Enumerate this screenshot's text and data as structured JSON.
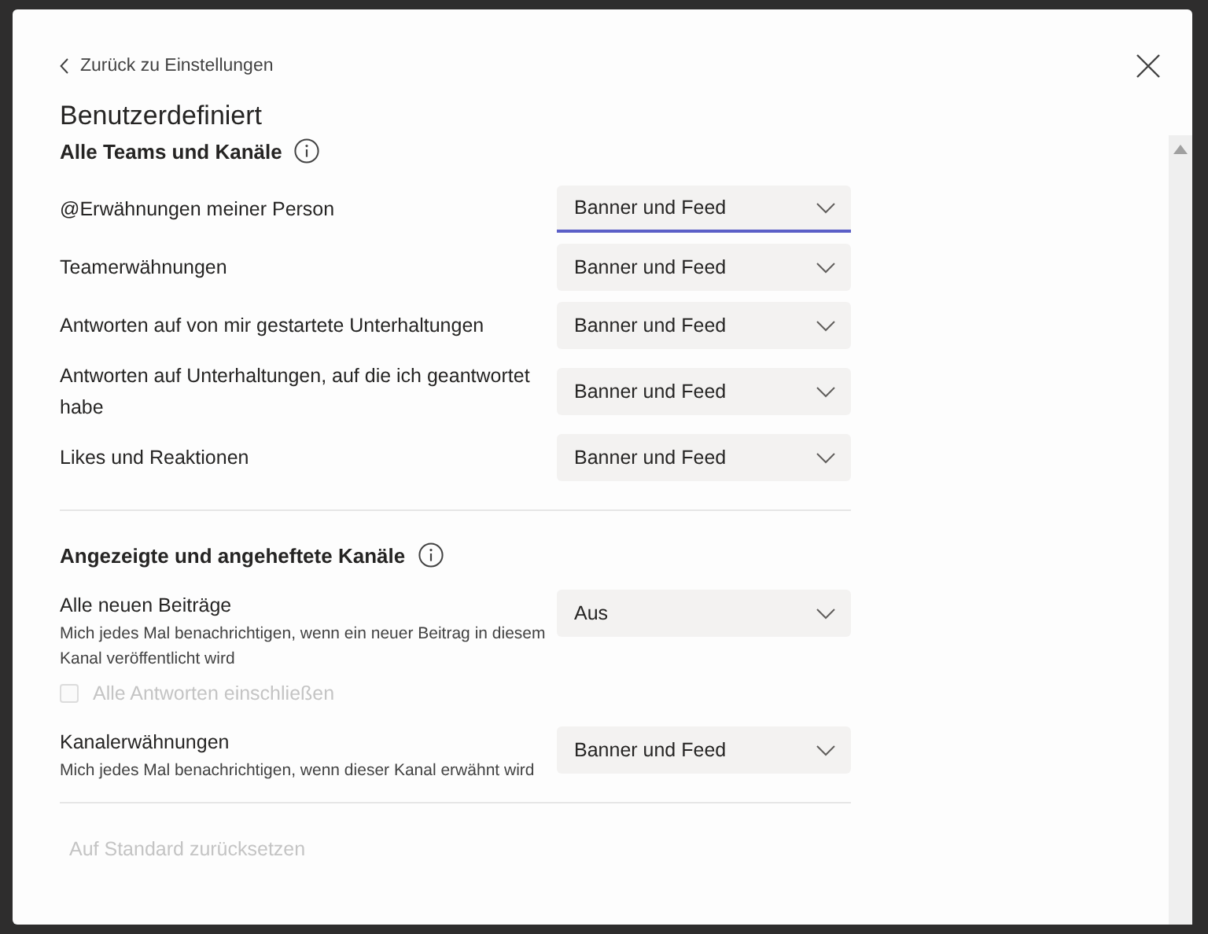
{
  "back_link": "Zurück zu Einstellungen",
  "title": "Benutzerdefiniert",
  "sections": [
    {
      "heading": "Alle Teams und Kanäle",
      "settings": [
        {
          "label": "@Erwähnungen meiner Person",
          "value": "Banner und Feed",
          "focused": true
        },
        {
          "label": "Teamerwähnungen",
          "value": "Banner und Feed",
          "focused": false
        },
        {
          "label": "Antworten auf von mir gestartete Unterhaltungen",
          "value": "Banner und Feed",
          "focused": false
        },
        {
          "label": "Antworten auf Unterhaltungen, auf die ich geantwortet habe",
          "value": "Banner und Feed",
          "focused": false
        },
        {
          "label": "Likes und Reaktionen",
          "value": "Banner und Feed",
          "focused": false
        }
      ]
    },
    {
      "heading": "Angezeigte und angeheftete Kanäle",
      "settings": [
        {
          "label": "Alle neuen Beiträge",
          "description": "Mich jedes Mal benachrichtigen, wenn ein neuer Beitrag in diesem Kanal veröffentlicht wird",
          "value": "Aus",
          "focused": false,
          "checkbox": {
            "label": "Alle Antworten einschließen",
            "checked": false,
            "disabled": true
          }
        },
        {
          "label": "Kanalerwähnungen",
          "description": "Mich jedes Mal benachrichtigen, wenn dieser Kanal erwähnt wird",
          "value": "Banner und Feed",
          "focused": false
        }
      ]
    }
  ],
  "reset_button": {
    "label": "Auf Standard zurücksetzen",
    "disabled": true
  }
}
